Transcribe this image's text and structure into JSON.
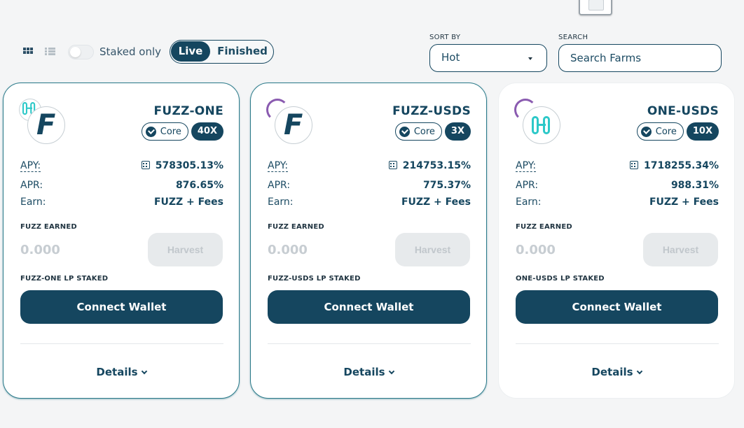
{
  "toolbar": {
    "staked_only_label": "Staked only",
    "staked_only_on": false,
    "live_label": "Live",
    "finished_label": "Finished",
    "sort_label": "SORT BY",
    "sort_value": "Hot",
    "search_label": "SEARCH",
    "search_placeholder": "Search Farms"
  },
  "colors": {
    "primary": "#15465f",
    "card_border": "#2b7a8a",
    "disabled": "#e7eaec",
    "harmony": "#2cc8c8",
    "usds": "#8a5bb0"
  },
  "farms": [
    {
      "pair": "FUZZ-ONE",
      "core_label": "Core",
      "multiplier": "40X",
      "apy_label": "APY:",
      "apy": "578305.13%",
      "apr_label": "APR:",
      "apr": "876.65%",
      "earn_label": "Earn:",
      "earn": "FUZZ + Fees",
      "earned_label": "FUZZ EARNED",
      "earned_value": "0.000",
      "harvest_label": "Harvest",
      "staked_label": "FUZZ-ONE LP STAKED",
      "connect_label": "Connect Wallet",
      "details_label": "Details",
      "token_icons": [
        "harmony-icon",
        "fuzz-icon"
      ]
    },
    {
      "pair": "FUZZ-USDS",
      "core_label": "Core",
      "multiplier": "3X",
      "apy_label": "APY:",
      "apy": "214753.15%",
      "apr_label": "APR:",
      "apr": "775.37%",
      "earn_label": "Earn:",
      "earn": "FUZZ + Fees",
      "earned_label": "FUZZ EARNED",
      "earned_value": "0.000",
      "harvest_label": "Harvest",
      "staked_label": "FUZZ-USDS LP STAKED",
      "connect_label": "Connect Wallet",
      "details_label": "Details",
      "token_icons": [
        "usds-icon",
        "fuzz-icon"
      ]
    },
    {
      "pair": "ONE-USDS",
      "core_label": "Core",
      "multiplier": "10X",
      "apy_label": "APY:",
      "apy": "1718255.34%",
      "apr_label": "APR:",
      "apr": "988.31%",
      "earn_label": "Earn:",
      "earn": "FUZZ + Fees",
      "earned_label": "FUZZ EARNED",
      "earned_value": "0.000",
      "harvest_label": "Harvest",
      "staked_label": "ONE-USDS LP STAKED",
      "connect_label": "Connect Wallet",
      "details_label": "Details",
      "token_icons": [
        "usds-icon",
        "harmony-icon"
      ]
    }
  ]
}
